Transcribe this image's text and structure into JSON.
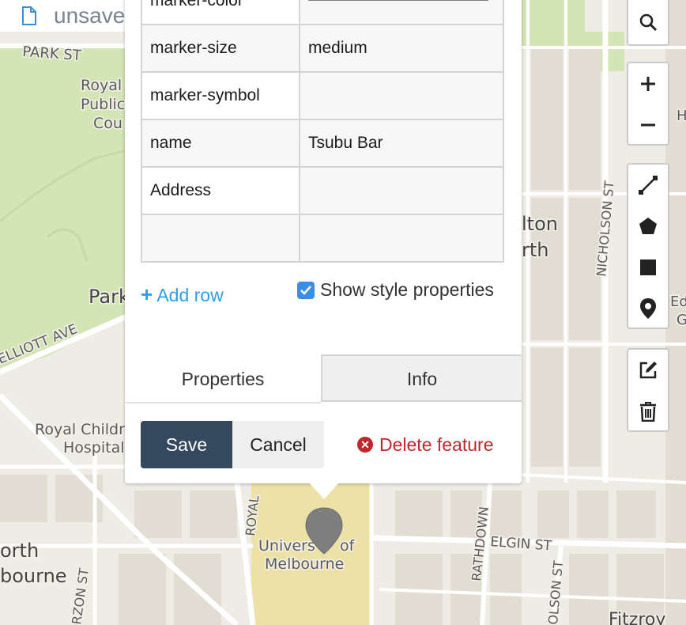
{
  "map": {
    "labels": {
      "park_st": "PARK ST",
      "royal_public_1": "Royal",
      "royal_public_2": "Public",
      "royal_public_3": "Cou",
      "parkville": "Park",
      "elliott_ave": "ELLIOTT AVE",
      "royal_childrens_1": "Royal Childr",
      "royal_childrens_2": "Hospital",
      "north_melbourne_1": "orth",
      "north_melbourne_2": "bourne",
      "curzon_st": "RZON ST",
      "royal_pde": "ROYAL",
      "university_1": "Univers",
      "university_of": "of",
      "university_2": "Melbourne",
      "rathdowne": "RATHDOWN",
      "elgin_st": "ELGIN ST",
      "nicholson_st": "NICHOLSON ST",
      "nicholson_st_2": "OLSON ST",
      "carlton_north_1": "lton",
      "carlton_north_2": "rth",
      "fitzroy": "Fitzroy",
      "edge_ed": "Ed",
      "edge_g": "G",
      "edge_h": "H"
    }
  },
  "file": {
    "status": "unsaved",
    "icon": "document-icon"
  },
  "popup": {
    "properties": [
      {
        "key": "marker-color",
        "value": "",
        "swatch": "#7e7e7e"
      },
      {
        "key": "marker-size",
        "value": "medium"
      },
      {
        "key": "marker-symbol",
        "value": ""
      },
      {
        "key": "name",
        "value": "Tsubu Bar"
      },
      {
        "key": "Address",
        "value": ""
      },
      {
        "key": "",
        "value": ""
      }
    ],
    "add_row_plus": "+",
    "add_row_label": "Add row",
    "show_style_label": "Show style properties",
    "show_style_checked": true,
    "tabs": [
      {
        "label": "Properties",
        "active": true
      },
      {
        "label": "Info",
        "active": false
      }
    ],
    "save_label": "Save",
    "cancel_label": "Cancel",
    "delete_label": "Delete feature"
  },
  "toolbar": {
    "groups": [
      [
        "search-icon"
      ],
      [
        "zoom-in-icon",
        "zoom-out-icon"
      ],
      [
        "draw-line-icon",
        "draw-polygon-icon",
        "draw-rectangle-icon",
        "draw-marker-icon"
      ],
      [
        "edit-icon",
        "trash-icon"
      ]
    ]
  },
  "colors": {
    "map_bg": "#efece6",
    "park": "#d3e4b5",
    "campus": "#ece1a6",
    "save_button": "#34495e",
    "link_blue": "#2e9ee8",
    "delete_red": "#c0272d",
    "marker": "#7e7e7e"
  }
}
